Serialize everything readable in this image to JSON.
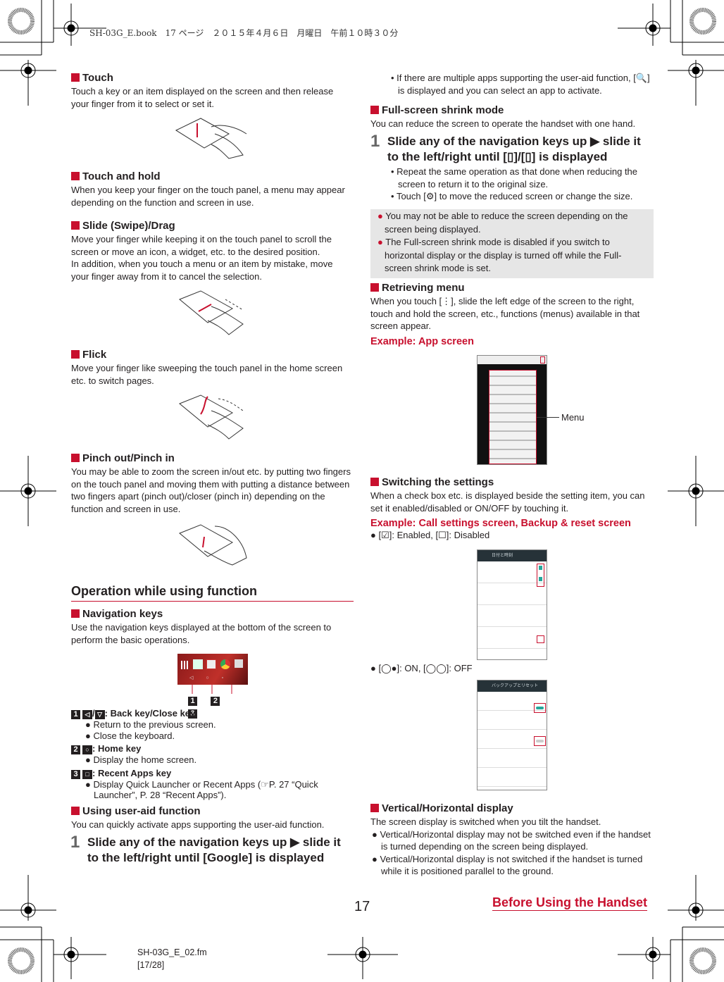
{
  "header": {
    "print_info": "SH-03G_E.book　17 ページ　２０１５年４月６日　月曜日　午前１０時３０分"
  },
  "left": {
    "touch": {
      "title": "Touch",
      "text": "Touch a key or an item displayed on the screen and then release your finger from it to select or set it."
    },
    "touch_hold": {
      "title": "Touch and hold",
      "text": "When you keep your finger on the touch panel, a menu may appear depending on the function and screen in use."
    },
    "slide": {
      "title": "Slide (Swipe)/Drag",
      "text": "Move your finger while keeping it on the touch panel to scroll the screen or move an icon, a widget, etc. to the desired position.",
      "text2": "In addition, when you touch a menu or an item by mistake, move your finger away from it to cancel the selection."
    },
    "flick": {
      "title": "Flick",
      "text": "Move your finger like sweeping the touch panel in the home screen etc. to switch pages."
    },
    "pinch": {
      "title": "Pinch out/Pinch in",
      "text": "You may be able to zoom the screen in/out etc. by putting two fingers on the touch panel and moving them with putting a distance between two fingers apart (pinch out)/closer (pinch in) depending on the function and screen in use."
    },
    "section_title": "Operation while using function",
    "nav": {
      "title": "Navigation keys",
      "text": "Use the navigation keys displayed at the bottom of the screen to perform the basic operations.",
      "callouts": [
        "1",
        "2",
        "3"
      ],
      "keys": [
        {
          "num": "1",
          "label": ": Back key/Close key",
          "bullets": [
            "Return to the previous screen.",
            "Close the keyboard."
          ]
        },
        {
          "num": "2",
          "label": ": Home key",
          "bullets": [
            "Display the home screen."
          ]
        },
        {
          "num": "3",
          "label": ": Recent Apps key",
          "bullets": [
            "Display Quick Launcher or Recent Apps (☞P. 27 “Quick Launcher”, P. 28 “Recent Apps”)."
          ]
        }
      ]
    },
    "user_aid": {
      "title": "Using user-aid function",
      "text": "You can quickly activate apps supporting the user-aid function.",
      "step_num": "1",
      "step": "Slide any of the navigation keys up ▶ slide it to the left/right until [Google] is displayed"
    }
  },
  "right": {
    "user_aid_note": "If there are multiple apps supporting the user-aid function, [🔍] is displayed and you can select an app to activate.",
    "shrink": {
      "title": "Full-screen shrink mode",
      "text": "You can reduce the screen to operate the handset with one hand.",
      "step_num": "1",
      "step": "Slide any of the navigation keys up ▶ slide it to the left/right until [▯]/[▯] is displayed",
      "bullets": [
        "Repeat the same operation as that done when reducing the screen to return it to the original size.",
        "Touch [⚙] to move the reduced screen or change the size."
      ],
      "notes": [
        "You may not be able to reduce the screen depending on the screen being displayed.",
        "The Full-screen shrink mode is disabled if you switch to horizontal display or the display is turned off while the Full-screen shrink mode is set."
      ]
    },
    "menu": {
      "title": "Retrieving menu",
      "text": "When you touch [⋮], slide the left edge of the screen to the right, touch and hold the screen, etc., functions (menus) available in that screen appear.",
      "example": "Example: App screen",
      "callout": "Menu"
    },
    "switching": {
      "title": "Switching the settings",
      "text": "When a check box etc. is displayed beside the setting item, you can set it enabled/disabled or ON/OFF by touching it.",
      "example": "Example: Call settings screen, Backup & reset screen",
      "check_legend": "[☑]: Enabled, [☐]: Disabled",
      "toggle_legend": "[◯●]: ON, [◯◯]: OFF",
      "screen1_title": "日付と時刻",
      "screen2_title": "バックアップとリセット"
    },
    "orientation": {
      "title": "Vertical/Horizontal display",
      "text": "The screen display is switched when you tilt the handset.",
      "bullets": [
        "Vertical/Horizontal display may not be switched even if the handset is turned depending on the screen being displayed.",
        "Vertical/Horizontal display is not switched if the handset is turned while it is positioned parallel to the ground."
      ]
    }
  },
  "footer": {
    "page_number": "17",
    "chapter": "Before Using the Handset",
    "file": "SH-03G_E_02.fm",
    "pages": "[17/28]"
  },
  "colors": {
    "accent": "#c8102e",
    "note_bg": "#e6e6e6"
  }
}
